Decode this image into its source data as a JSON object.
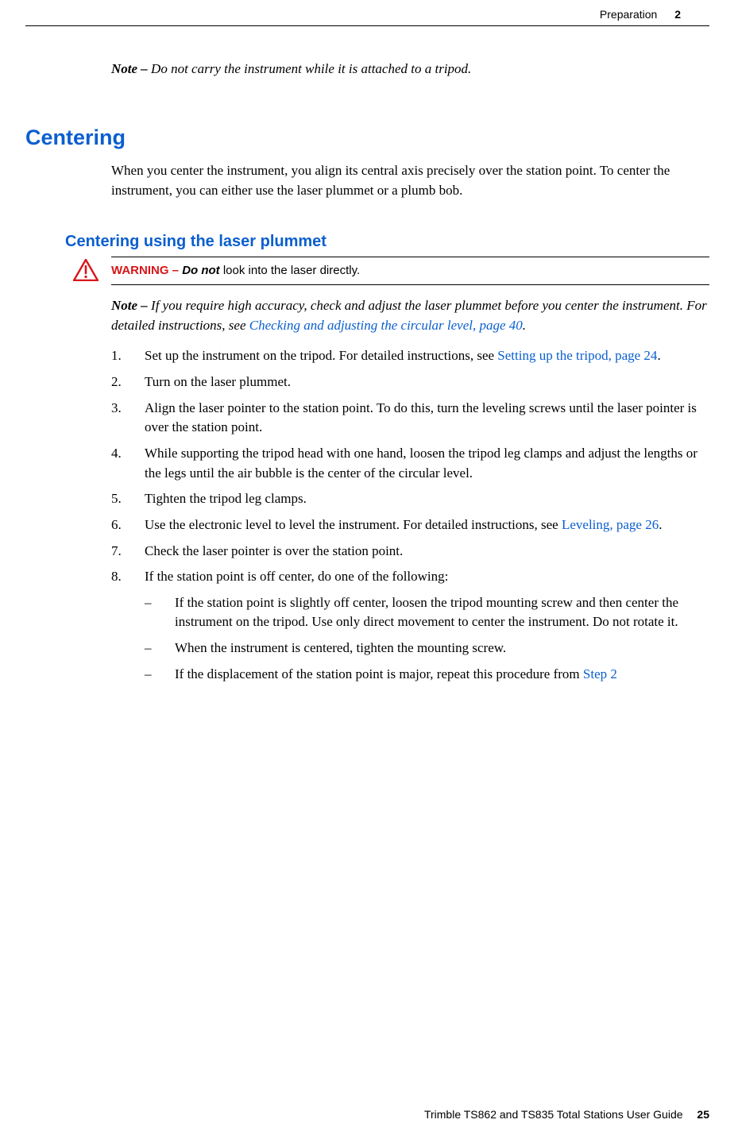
{
  "header": {
    "section_title": "Preparation",
    "section_number": "2"
  },
  "note_top": {
    "label": "Note –",
    "text": "Do not carry the instrument while it is attached to a tripod."
  },
  "h1": "Centering",
  "intro": "When you center the instrument, you align its central axis precisely over the station point. To center the instrument, you can either use the laser plummet or a plumb bob.",
  "h2": "Centering using the laser plummet",
  "warning": {
    "label": "WARNING –",
    "bold": "Do not",
    "rest": " look into the laser directly."
  },
  "note2": {
    "label": "Note –",
    "pre": "If you require high accuracy, check and adjust the laser plummet before you center the instrument. For detailed instructions, see ",
    "link": "Checking and adjusting the circular level, page 40",
    "post": "."
  },
  "steps": [
    {
      "n": "1.",
      "pre": "Set up the instrument on the tripod. For detailed instructions, see ",
      "link": "Setting up the tripod, page 24",
      "post": "."
    },
    {
      "n": "2.",
      "pre": "Turn on the laser plummet."
    },
    {
      "n": "3.",
      "pre": "Align the laser pointer to the station point. To do this, turn the leveling screws until the laser pointer is over the station point."
    },
    {
      "n": "4.",
      "pre": "While supporting the tripod head with one hand, loosen the tripod leg clamps and adjust the lengths or the legs until the air bubble is the center of the circular level."
    },
    {
      "n": "5.",
      "pre": "Tighten the tripod leg clamps."
    },
    {
      "n": "6.",
      "pre": "Use the electronic level to level the instrument. For detailed instructions, see ",
      "link": "Leveling, page 26",
      "post": "."
    },
    {
      "n": "7.",
      "pre": "Check the laser pointer is over the station point."
    },
    {
      "n": "8.",
      "pre": "If the station point is off center, do one of the following:",
      "subs": [
        {
          "dash": "–",
          "text": "If the station point is slightly off center, loosen the tripod mounting screw and then center the instrument on the tripod. Use only direct movement to center the instrument. Do not rotate it."
        },
        {
          "dash": "–",
          "text": "When the instrument is centered, tighten the mounting screw."
        },
        {
          "dash": "–",
          "pre": "If the displacement of the station point is major, repeat this procedure from ",
          "link": "Step 2"
        }
      ]
    }
  ],
  "footer": {
    "title": "Trimble TS862 and TS835 Total Stations User Guide",
    "page": "25"
  }
}
